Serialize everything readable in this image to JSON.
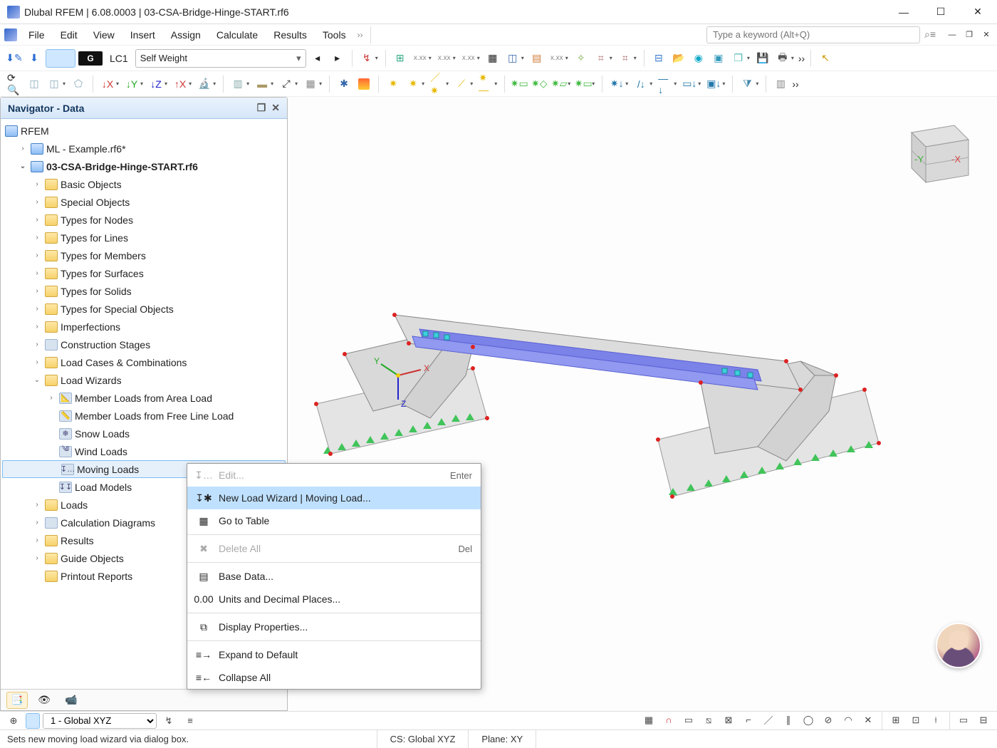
{
  "app": {
    "title": "Dlubal RFEM | 6.08.0003 | 03-CSA-Bridge-Hinge-START.rf6"
  },
  "menu": {
    "items": [
      "File",
      "Edit",
      "View",
      "Insert",
      "Assign",
      "Calculate",
      "Results",
      "Tools"
    ],
    "overflow_glyph": "››",
    "search_placeholder": "Type a keyword (Alt+Q)"
  },
  "loadcase_bar": {
    "badge": "G",
    "lc_code": "LC1",
    "lc_name": "Self Weight"
  },
  "navigator": {
    "title": "Navigator - Data",
    "root": "RFEM",
    "files": [
      {
        "label": "ML - Example.rf6*",
        "active": false
      },
      {
        "label": "03-CSA-Bridge-Hinge-START.rf6",
        "active": true
      }
    ],
    "folders_level1": [
      "Basic Objects",
      "Special Objects",
      "Types for Nodes",
      "Types for Lines",
      "Types for Members",
      "Types for Surfaces",
      "Types for Solids",
      "Types for Special Objects",
      "Imperfections"
    ],
    "construction_stages": "Construction Stages",
    "load_cases_combos": "Load Cases & Combinations",
    "load_wizards": {
      "label": "Load Wizards",
      "children": [
        "Member Loads from Area Load",
        "Member Loads from Free Line Load",
        "Snow Loads",
        "Wind Loads",
        "Moving Loads",
        "Load Models"
      ],
      "highlighted_index": 4
    },
    "folders_after": [
      "Loads",
      "Calculation Diagrams",
      "Results",
      "Guide Objects",
      "Printout Reports"
    ]
  },
  "context_menu": {
    "items": [
      {
        "label": "Edit...",
        "accel": "Enter",
        "disabled": true
      },
      {
        "label": "New Load Wizard | Moving Load...",
        "hover": true
      },
      {
        "label": "Go to Table"
      },
      {
        "sep": true
      },
      {
        "label": "Delete All",
        "accel": "Del",
        "disabled": true
      },
      {
        "sep": true
      },
      {
        "label": "Base Data..."
      },
      {
        "label": "Units and Decimal Places..."
      },
      {
        "sep": true
      },
      {
        "label": "Display Properties..."
      },
      {
        "sep": true
      },
      {
        "label": "Expand to Default"
      },
      {
        "label": "Collapse All"
      }
    ]
  },
  "bottombar": {
    "coord_system": "1 - Global XYZ"
  },
  "statusbar": {
    "hint": "Sets new moving load wizard via dialog box.",
    "cs": "CS: Global XYZ",
    "plane": "Plane: XY"
  },
  "viewcube": {
    "neg_y": "-Y",
    "neg_x": "-X"
  },
  "colors": {
    "accent_blue": "#3b7ddd",
    "highlight": "#bfe1ff"
  }
}
